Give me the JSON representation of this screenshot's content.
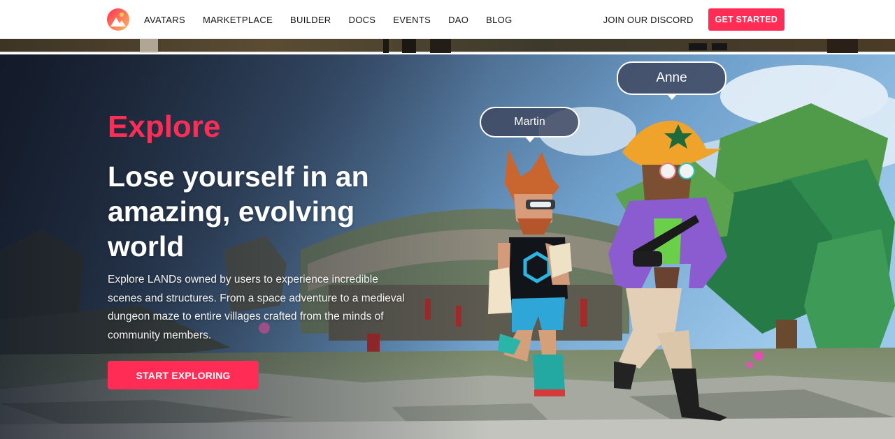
{
  "nav": {
    "links": [
      "AVATARS",
      "MARKETPLACE",
      "BUILDER",
      "DOCS",
      "EVENTS",
      "DAO",
      "BLOG"
    ],
    "discord": "JOIN OUR DISCORD",
    "get_started": "GET STARTED"
  },
  "hero": {
    "eyebrow": "Explore",
    "headline": "Lose yourself in an amazing, evolving world",
    "description": "Explore LANDs owned by users to experience incredible scenes and structures. From a space adventure to a medieval dungeon maze to entire villages crafted from the minds of community members.",
    "cta": "START EXPLORING",
    "characters": [
      {
        "name": "Martin"
      },
      {
        "name": "Anne"
      }
    ]
  },
  "colors": {
    "accent": "#ff2d55",
    "text_dark": "#16141a"
  }
}
